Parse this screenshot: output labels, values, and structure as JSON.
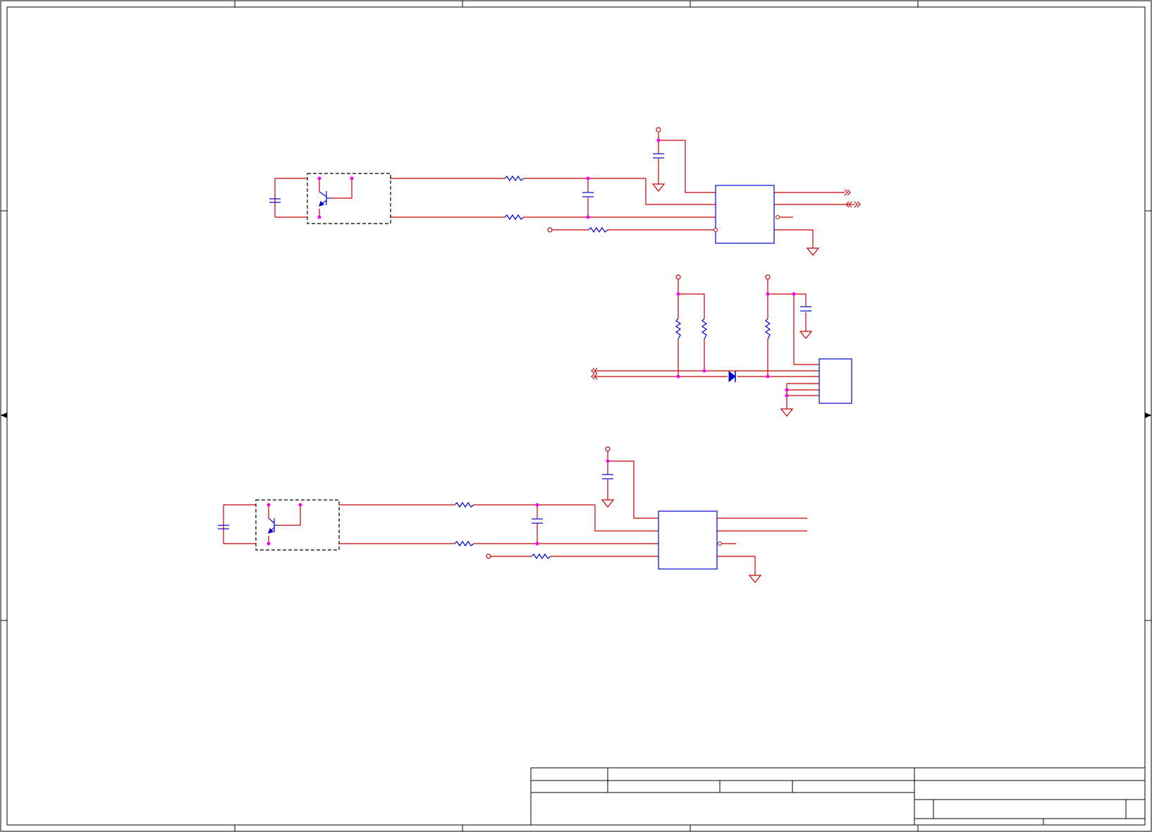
{
  "sheet": {
    "background": "#ffffff",
    "border_color": "#000000"
  },
  "colors": {
    "wire": "#cc0000",
    "net": "#800040",
    "component": "#0000cc",
    "junction": "#ff00ff",
    "frame": "#000000",
    "selection_box": "#000000"
  },
  "title_block": {
    "fields": []
  },
  "circuits": [
    {
      "id": "upper-channel",
      "components": [
        "phototransistor-optocoupler",
        "capacitor",
        "resistor",
        "resistor",
        "capacitor",
        "resistor",
        "ic"
      ]
    },
    {
      "id": "middle-interface",
      "components": [
        "resistor",
        "resistor",
        "resistor",
        "capacitor",
        "diode",
        "connector"
      ]
    },
    {
      "id": "lower-channel",
      "components": [
        "phototransistor-optocoupler",
        "capacitor",
        "resistor",
        "resistor",
        "capacitor",
        "resistor",
        "ic"
      ]
    }
  ]
}
